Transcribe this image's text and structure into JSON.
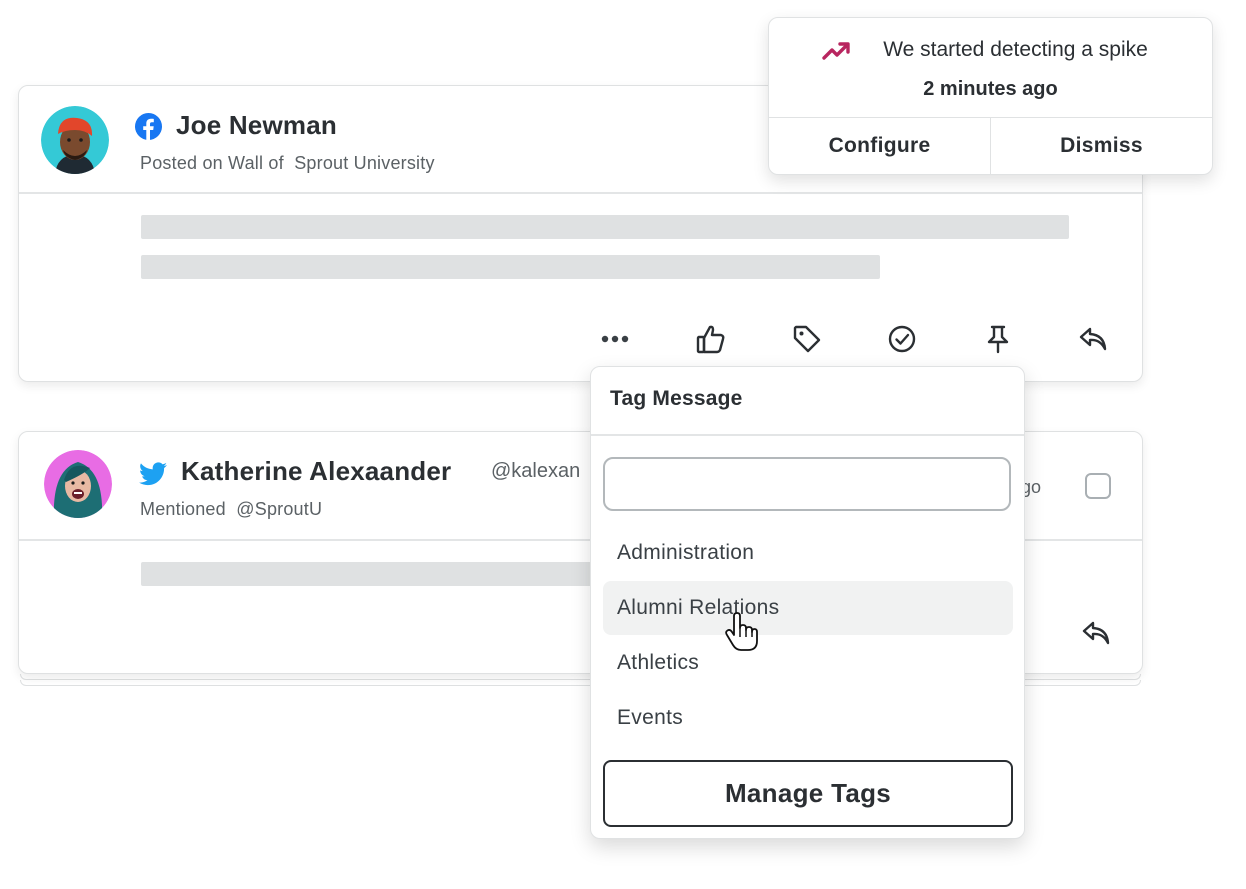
{
  "posts": [
    {
      "network": "facebook-icon",
      "author": "Joe Newman",
      "subtitle": "Posted on Wall of  Sprout University",
      "actions": [
        "more-icon",
        "like-icon",
        "tag-icon",
        "complete-icon",
        "pin-icon",
        "reply-icon"
      ]
    },
    {
      "network": "twitter-icon",
      "author": "Katherine Alexaander",
      "handle": "@kalexan",
      "subtitle": "Mentioned  @SproutU",
      "time_fragment": "go",
      "actions": [
        "reply-icon"
      ]
    }
  ],
  "alert": {
    "message": "We started detecting a spike",
    "time": "2 minutes ago",
    "configure_label": "Configure",
    "dismiss_label": "Dismiss",
    "accent_color": "#b8255f"
  },
  "tag_menu": {
    "title": "Tag Message",
    "search_value": "",
    "items": [
      "Administration",
      "Alumni Relations",
      "Athletics",
      "Events"
    ],
    "hovered_item": "Alumni Relations",
    "manage_label": "Manage Tags"
  },
  "colors": {
    "facebook": "#1877f2",
    "twitter": "#1da1f2",
    "skeleton": "#dfe1e2"
  }
}
